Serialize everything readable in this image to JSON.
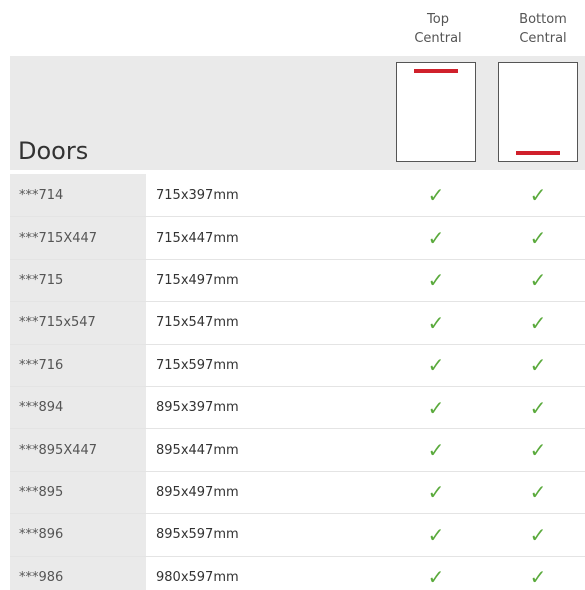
{
  "columns": {
    "top_central": [
      "Top",
      "Central"
    ],
    "bottom_central": [
      "Bottom",
      "Central"
    ]
  },
  "banner": {
    "title": "Doors"
  },
  "check_glyph": "✓",
  "colors": {
    "accent_red": "#d0202b",
    "check_green": "#5aaa3c",
    "banner_grey": "#eaeaea"
  },
  "rows": [
    {
      "code": "***714",
      "size": "715x397mm",
      "top": "✓",
      "bottom": "✓"
    },
    {
      "code": "***715X447",
      "size": "715x447mm",
      "top": "✓",
      "bottom": "✓"
    },
    {
      "code": "***715",
      "size": "715x497mm",
      "top": "✓",
      "bottom": "✓"
    },
    {
      "code": "***715x547",
      "size": "715x547mm",
      "top": "✓",
      "bottom": "✓"
    },
    {
      "code": "***716",
      "size": "715x597mm",
      "top": "✓",
      "bottom": "✓"
    },
    {
      "code": "***894",
      "size": "895x397mm",
      "top": "✓",
      "bottom": "✓"
    },
    {
      "code": "***895X447",
      "size": "895x447mm",
      "top": "✓",
      "bottom": "✓"
    },
    {
      "code": "***895",
      "size": "895x497mm",
      "top": "✓",
      "bottom": "✓"
    },
    {
      "code": "***896",
      "size": "895x597mm",
      "top": "✓",
      "bottom": "✓"
    },
    {
      "code": "***986",
      "size": "980x597mm",
      "top": "✓",
      "bottom": "✓"
    }
  ]
}
